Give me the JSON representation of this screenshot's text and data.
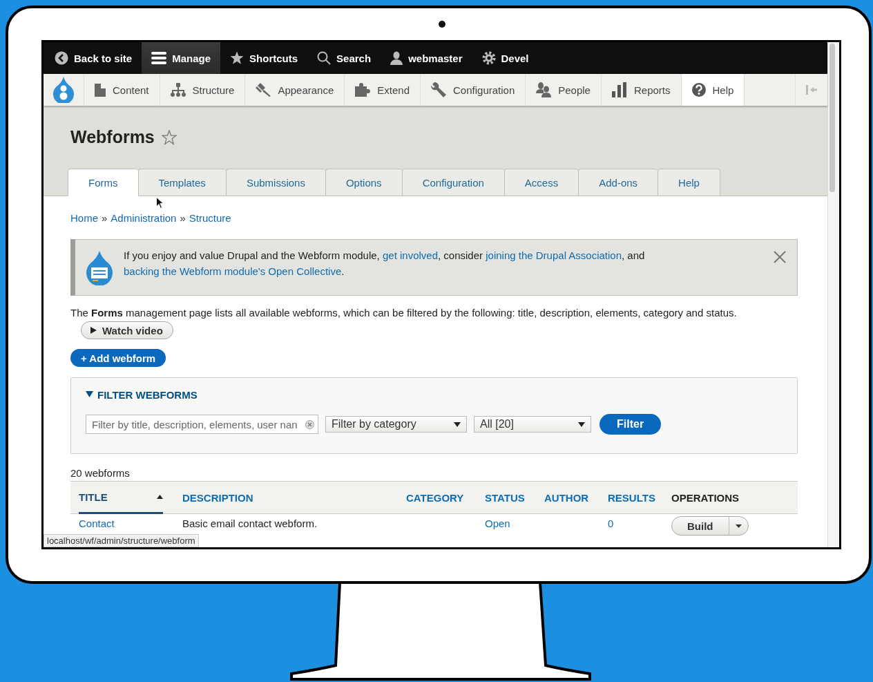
{
  "toolbar": {
    "items": [
      {
        "label": "Back to site",
        "selected": false
      },
      {
        "label": "Manage",
        "selected": true
      },
      {
        "label": "Shortcuts",
        "selected": false
      },
      {
        "label": "Search",
        "selected": false
      },
      {
        "label": "webmaster",
        "selected": false
      },
      {
        "label": "Devel",
        "selected": false
      }
    ]
  },
  "admin_menu": {
    "items": [
      {
        "label": "Content",
        "selected": false
      },
      {
        "label": "Structure",
        "selected": false
      },
      {
        "label": "Appearance",
        "selected": false
      },
      {
        "label": "Extend",
        "selected": false
      },
      {
        "label": "Configuration",
        "selected": false
      },
      {
        "label": "People",
        "selected": false
      },
      {
        "label": "Reports",
        "selected": false
      },
      {
        "label": "Help",
        "selected": true
      }
    ]
  },
  "page": {
    "title": "Webforms",
    "starred": false
  },
  "tabs": [
    {
      "label": "Forms",
      "selected": true
    },
    {
      "label": "Templates",
      "selected": false
    },
    {
      "label": "Submissions",
      "selected": false
    },
    {
      "label": "Options",
      "selected": false
    },
    {
      "label": "Configuration",
      "selected": false
    },
    {
      "label": "Access",
      "selected": false
    },
    {
      "label": "Add-ons",
      "selected": false
    },
    {
      "label": "Help",
      "selected": false
    }
  ],
  "breadcrumb": {
    "separator": "»",
    "items": [
      "Home",
      "Administration",
      "Structure"
    ]
  },
  "message": {
    "parts": [
      {
        "text": "If you enjoy and value Drupal and the Webform module,",
        "link": false
      },
      {
        "text": "get involved",
        "link": true
      },
      {
        "text": ", consider",
        "link": false
      },
      {
        "text": "joining the Drupal Association",
        "link": true
      },
      {
        "text": ", and",
        "link": false
      },
      {
        "text": "backing the Webform module's Open Collective",
        "link": true
      },
      {
        "text": ".",
        "link": false
      }
    ]
  },
  "description": "The **Forms** management page lists all available webforms, which can be filtered by the following: title, description, elements, category and status.",
  "watch_video": "Watch video",
  "add_button": "+ Add webform",
  "filter": {
    "title": "FILTER WEBFORMS",
    "expanded": true,
    "search_placeholder": "Filter by title, description, elements, user nan",
    "category": "Filter by category",
    "status": "All [20]",
    "button": "Filter"
  },
  "count": "20 webforms",
  "table": {
    "columns": [
      {
        "label": "TITLE",
        "sortable": true,
        "sorted": true
      },
      {
        "label": "DESCRIPTION",
        "sortable": true,
        "sorted": false
      },
      {
        "label": "CATEGORY",
        "sortable": true,
        "sorted": false
      },
      {
        "label": "STATUS",
        "sortable": true,
        "sorted": false
      },
      {
        "label": "AUTHOR",
        "sortable": true,
        "sorted": false
      },
      {
        "label": "RESULTS",
        "sortable": true,
        "sorted": false
      },
      {
        "label": "OPERATIONS",
        "sortable": false,
        "sorted": false
      }
    ],
    "rows": [
      {
        "title": "Contact",
        "description": "Basic email contact webform.",
        "status": "Open",
        "results": "0",
        "operation": "Build"
      }
    ]
  },
  "status_bar": {
    "url": "localhost/wf/admin/structure/webform"
  }
}
